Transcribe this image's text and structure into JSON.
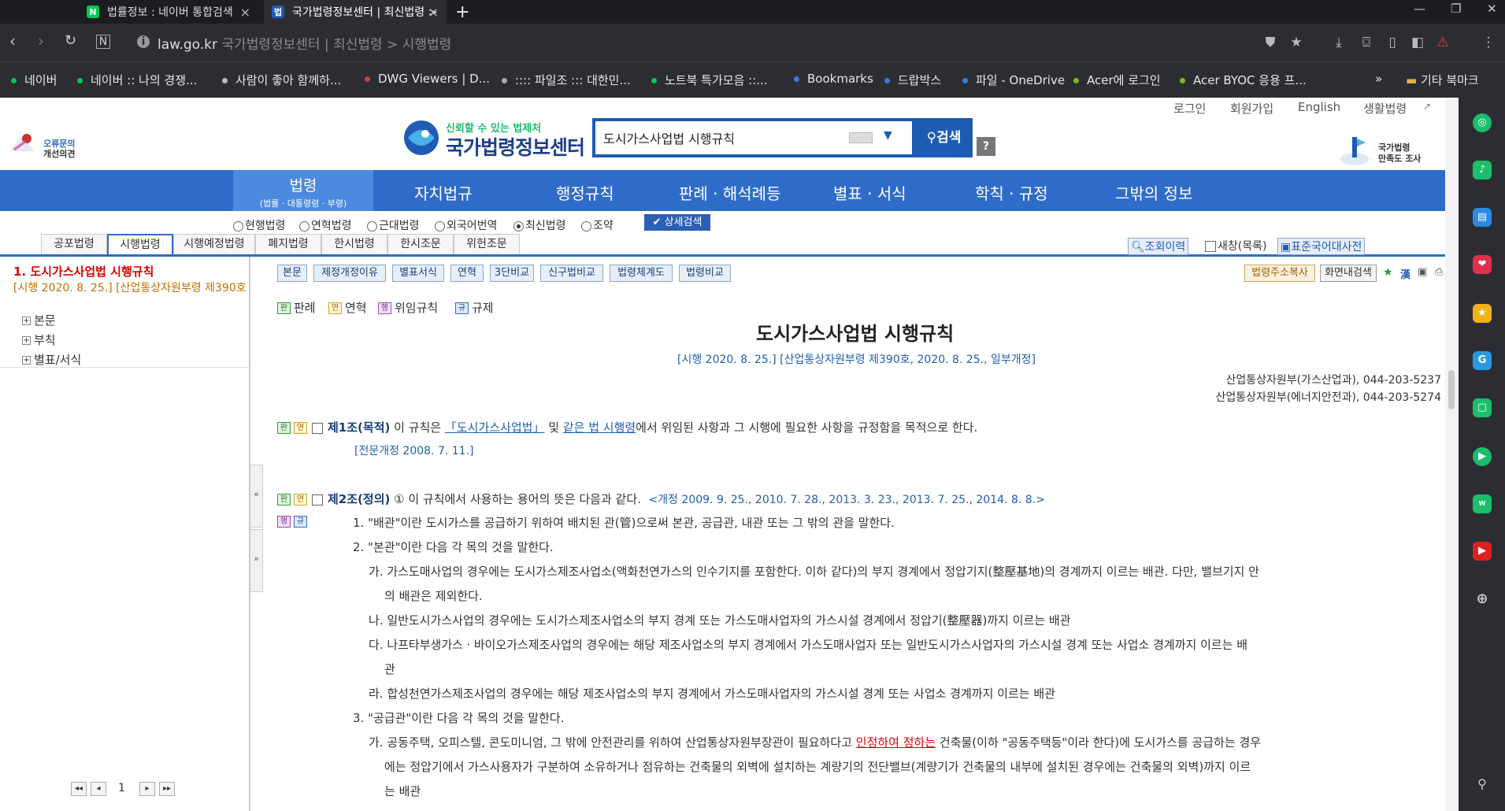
{
  "browser": {
    "tabs": [
      {
        "label": "법률정보 : 네이버 통합검색",
        "favicon": "N",
        "color": "#03c75a"
      },
      {
        "label": "국가법령정보센터 | 최신법령 >",
        "favicon": "법",
        "color": "#1e5bb5"
      }
    ],
    "new_tab": "+",
    "url_domain": "law.go.kr",
    "url_title": "국가법령정보센터 | 최신법령 > 시행법령",
    "bookmarks": [
      {
        "label": "네이버",
        "color": "#03c75a"
      },
      {
        "label": "네이버 :: 나의 경쟁...",
        "color": "#03c75a"
      },
      {
        "label": "사람이 좋아 함께하...",
        "color": "#bbbbbb"
      },
      {
        "label": "DWG Viewers | D...",
        "color": "#d33c3c"
      },
      {
        "label": ":::: 파일조 ::: 대한민...",
        "color": "#aaaaaa"
      },
      {
        "label": "노트북 특가모음 ::...",
        "color": "#03c75a"
      },
      {
        "label": "Bookmarks",
        "color": "#3a7de0"
      },
      {
        "label": "드랍박스",
        "color": "#3a7de0"
      },
      {
        "label": "파일 - OneDrive",
        "color": "#3a7de0"
      },
      {
        "label": "Acer에 로그인",
        "color": "#83b81a"
      },
      {
        "label": "Acer BYOC 응용 프...",
        "color": "#83b81a"
      }
    ],
    "more": "»",
    "other_bookmarks": "기타 북마크"
  },
  "site": {
    "top_links": [
      "로그인",
      "회원가입",
      "English",
      "생활법령"
    ],
    "feedback": [
      "오류문의",
      "개선의견"
    ],
    "logo_slogan": "신뢰할 수 있는 법제처",
    "logo_name": "국가법령정보센터",
    "search_value": "도시가스사업법 시행규칙",
    "search_button": "검색",
    "help": "?",
    "survey": [
      "국가법령",
      "만족도 조사"
    ]
  },
  "nav": {
    "active_label": "법령",
    "active_sub": "(법률 · 대통령령 · 부령)",
    "items": [
      "자치법규",
      "행정규칙",
      "판례 · 해석례등",
      "별표 · 서식",
      "학칙 · 규정",
      "그밖의 정보"
    ]
  },
  "filters": {
    "radios": [
      {
        "label": "현행법령",
        "checked": false
      },
      {
        "label": "연혁법령",
        "checked": false
      },
      {
        "label": "근대법령",
        "checked": false
      },
      {
        "label": "외국어번역",
        "checked": false
      },
      {
        "label": "최신법령",
        "checked": true
      },
      {
        "label": "조약",
        "checked": false
      }
    ],
    "detail_search": "상세검색",
    "subtabs": [
      "공포법령",
      "시행법령",
      "시행예정법령",
      "폐지법령",
      "한시법령",
      "한시조문",
      "위헌조문"
    ],
    "active_subtab": "시행법령",
    "right": [
      "조회이력",
      "새창(목록)",
      "표준국어대사전"
    ]
  },
  "left": {
    "title": "1.  도시가스사업법 시행규칙",
    "subtitle": "[시행 2020. 8. 25.] [산업통상자원부령 제390호",
    "tree": [
      "본문",
      "부칙",
      "별표/서식"
    ],
    "page": "1"
  },
  "main": {
    "toolbar": [
      "본문",
      "제정개정이유",
      "별표서식",
      "연혁",
      "3단비교",
      "신구법비교",
      "법령체계도",
      "법령비교"
    ],
    "toolbar_right": [
      "법령주소복사",
      "화면내검색"
    ],
    "legend": [
      {
        "badge": "판",
        "label": "판례"
      },
      {
        "badge": "연",
        "label": "연혁"
      },
      {
        "badge": "행",
        "label": "위임규칙"
      },
      {
        "badge": "규",
        "label": "규제"
      }
    ],
    "title": "도시가스사업법 시행규칙",
    "meta": "[시행 2020. 8. 25.] [산업통상자원부령 제390호, 2020. 8. 25., 일부개정]",
    "dept1": "산업통상자원부(가스산업과), 044-203-5237",
    "dept2": "산업통상자원부(에너지안전과), 044-203-5274",
    "art1_head": "제1조(목적)",
    "art1_a": " 이 규칙은 ",
    "art1_link1": "「도시가스사업법」",
    "art1_b": " 및 ",
    "art1_link2": "같은 법 시행령",
    "art1_c": "에서 위임된 사항과 그 시행에 필요한 사항을 규정함을 목적으로 한다.",
    "art1_amend": "[전문개정 2008. 7. 11.]",
    "art2_head": "제2조(정의)",
    "art2_a": " ① 이 규칙에서 사용하는 용어의 뜻은 다음과 같다.",
    "art2_amend": "<개정 2009. 9. 25., 2010. 7. 28., 2013. 3. 23., 2013. 7. 25., 2014. 8. 8.>",
    "l1": "1. \"배관\"이란 도시가스를 공급하기 위하여 배치된 관(管)으로써 본관, 공급관, 내관 또는 그 밖의 관을 말한다.",
    "l2": "2. \"본관\"이란 다음 각 목의 것을 말한다.",
    "l3": "가. 가스도매사업의 경우에는 도시가스제조사업소(액화천연가스의 인수기지를 포함한다. 이하 같다)의 부지 경계에서 정압기지(整壓基地)의 경계까지 이르는 배관. 다만, 밸브기지 안",
    "l3b": "의 배관은 제외한다.",
    "l4": "나. 일반도시가스사업의 경우에는 도시가스제조사업소의 부지 경계 또는 가스도매사업자의 가스시설 경계에서 정압기(整壓器)까지 이르는 배관",
    "l5": "다. 나프타부생가스ㆍ바이오가스제조사업의 경우에는 해당 제조사업소의 부지 경계에서 가스도매사업자 또는 일반도시가스사업자의 가스시설 경계 또는 사업소 경계까지 이르는 배",
    "l5b": "관",
    "l6": "라. 합성천연가스제조사업의 경우에는 해당 제조사업소의 부지 경계에서 가스도매사업자의 가스시설 경계 또는 사업소 경계까지 이르는 배관",
    "l7": "3. \"공급관\"이란 다음 각 목의 것을 말한다.",
    "l8a": "가. 공동주택, 오피스텔, 콘도미니엄, 그 밖에 안전관리를 위하여 산업통상자원부장관이 필요하다고 ",
    "l8red": "인정하여 정하는",
    "l8b": " 건축물(이하 \"공동주택등\"이라 한다)에 도시가스를 공급하는 경우",
    "l9": "에는 정압기에서 가스사용자가 구분하여 소유하거나 점유하는 건축물의 외벽에 설치하는 계량기의 전단밸브(계량기가 건축물의 내부에 설치된 경우에는 건축물의 외벽)까지 이르",
    "l10": "는 배관"
  },
  "colors": {
    "accent": "#2f6cc9",
    "dark_chrome": "#2c2d33",
    "red": "#dd0000"
  }
}
